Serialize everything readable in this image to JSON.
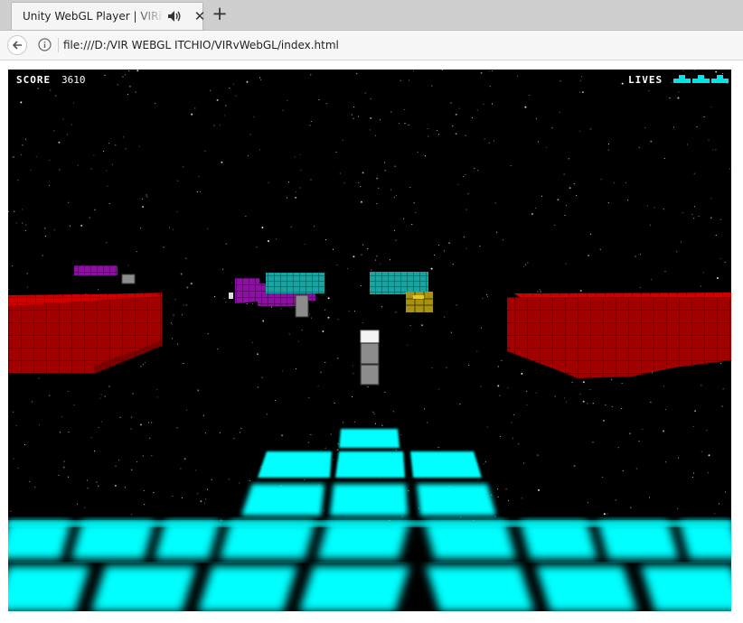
{
  "browser": {
    "tab_title": "Unity WebGL Player | VIRitch",
    "url": "file:///D:/VIR WEBGL ITCHIO/VIRvWebGL/index.html",
    "new_tab_label": "+",
    "close_label": "✕"
  },
  "game": {
    "score_label": "SCORE",
    "score_value": "3610",
    "lives_label": "LIVES",
    "lives_count": 3,
    "colors": {
      "floor": "#00ffff",
      "walls": "#aa0000",
      "purple_blocks": "#8b12a0",
      "teal_blocks": "#1aa3a0",
      "yellow_blocks": "#b09a10",
      "grey_blocks": "#8e8e8e",
      "hud_lives": "#00e5e5"
    }
  }
}
